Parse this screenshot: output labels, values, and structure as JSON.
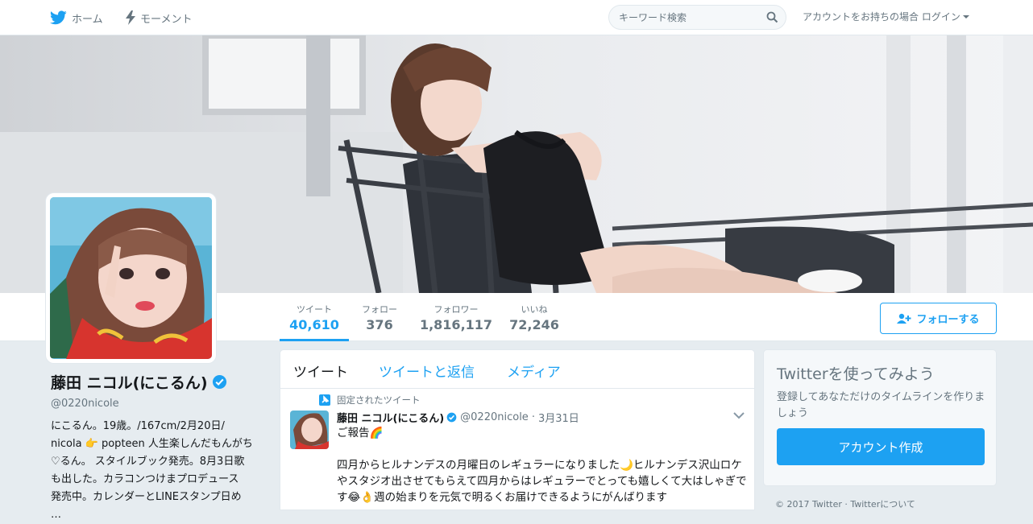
{
  "colors": {
    "accent": "#1da1f2",
    "text": "#14171a",
    "muted": "#66757f",
    "bg": "#e6ecf0"
  },
  "nav": {
    "home_label": "ホーム",
    "moments_label": "モーメント",
    "search_placeholder": "キーワード検索",
    "login_label": "アカウントをお持ちの場合 ログイン"
  },
  "profile": {
    "name": "藤田 ニコル(にこるん)",
    "handle": "@0220nicole",
    "bio": "にこるん。19歳。/167cm/2月20日/\nnicola 👉 popteen 人生楽しんだもんがち\n♡るん。 スタイルブック発売。8月3日歌\nも出した。カラコンつけまプロデュース\n発売中。カレンダーとLINEスタンプ日め\n…"
  },
  "stats": [
    {
      "label": "ツイート",
      "value": "40,610"
    },
    {
      "label": "フォロー",
      "value": "376"
    },
    {
      "label": "フォロワー",
      "value": "1,816,117"
    },
    {
      "label": "いいね",
      "value": "72,246"
    }
  ],
  "follow_button": "フォローする",
  "tabs": [
    "ツイート",
    "ツイートと返信",
    "メディア"
  ],
  "tweet": {
    "pinned_label": "固定されたツイート",
    "name": "藤田 ニコル(にこるん)",
    "handle": "@0220nicole",
    "dot": "·",
    "date": "3月31日",
    "line1": "ご報告🌈",
    "line2": "四月からヒルナンデスの月曜日のレギュラーになりました🌙ヒルナンデス沢山ロケやスタジオ出させてもらえて四月からはレギュラーでとっても嬉しくて大はしゃぎです😂👌週の始まりを元気で明るくお届けできるようにがんばります"
  },
  "sidebar": {
    "title": "Twitterを使ってみよう",
    "description": "登録してあなただけのタイムラインを作りましょう",
    "cta": "アカウント作成"
  },
  "footer": "© 2017 Twitter · Twitterについて"
}
